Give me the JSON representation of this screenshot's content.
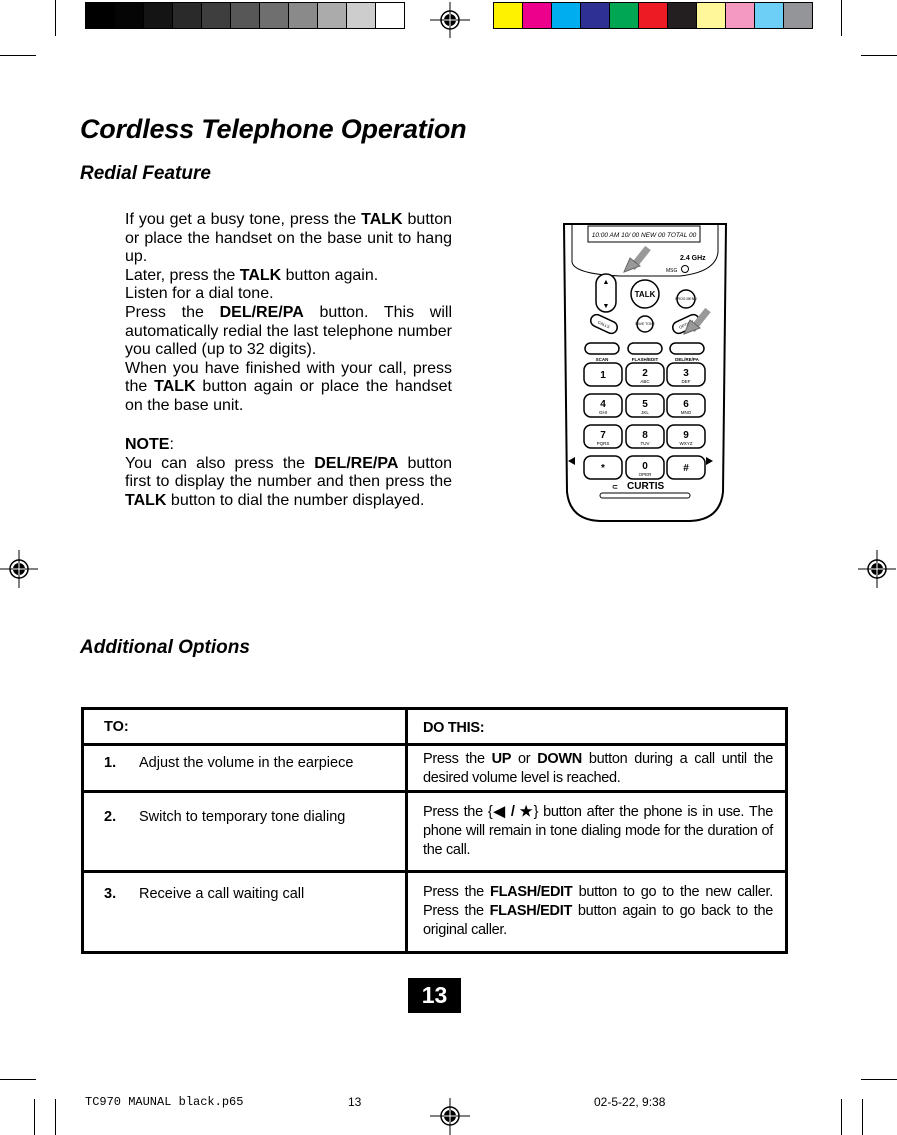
{
  "colors": {
    "grayscale": [
      "#000000",
      "#050505",
      "#141414",
      "#2a2a2a",
      "#3e3e3e",
      "#575757",
      "#6f6f6f",
      "#8a8a8a",
      "#ababab",
      "#cdcdcd",
      "#ffffff"
    ],
    "process": [
      "#fff200",
      "#ec008c",
      "#00aeef",
      "#2e3192",
      "#00a651",
      "#ed1c24",
      "#231f20",
      "#fff799",
      "#f49ac1",
      "#6dcff6",
      "#939598"
    ]
  },
  "title": "Cordless Telephone Operation",
  "redial": {
    "heading": "Redial Feature",
    "p1a": "If you get a busy tone, press the ",
    "talk": "TALK",
    "p1b": " button or place the handset on the base unit to hang up.",
    "p2a": "Later, press the ",
    "p2b": " button again.",
    "p3": "Listen for a dial tone.",
    "p4a": "Press the ",
    "del": "DEL/RE/PA",
    "p4b": " button. This will automatically redial the last telephone number you called (up to 32 digits).",
    "p5a": "When you have finished with your call, press the ",
    "p5b": " button again or place the handset on the base unit.",
    "note_label": "NOTE",
    "note_a": "You can also press the ",
    "note_b": " button first to display the number and then press the ",
    "note_c": " button to dial the number displayed."
  },
  "phone": {
    "display": "10:00 AM 10/ 00   NEW 00  TOTAL 00",
    "band": "2.4 GHz",
    "msg": "MSG",
    "talk": "TALK",
    "prog_menu": "PROG MENU",
    "calls": "CALLS",
    "save_tone": "SAVE TONE",
    "option": "OPTION",
    "soft_labels": [
      "SCAN",
      "FLASH/EDIT",
      "DEL/RE/PA"
    ],
    "keys": [
      [
        "1",
        ""
      ],
      [
        "2",
        "ABC"
      ],
      [
        "3",
        "DEF"
      ],
      [
        "4",
        "GHI"
      ],
      [
        "5",
        "JKL"
      ],
      [
        "6",
        "MNO"
      ],
      [
        "7",
        "PQRS"
      ],
      [
        "8",
        "TUV"
      ],
      [
        "9",
        "WXYZ"
      ],
      [
        "*",
        ""
      ],
      [
        "0",
        "OPER"
      ],
      [
        "#",
        ""
      ]
    ],
    "brand": "CURTIS"
  },
  "additional": {
    "heading": "Additional Options",
    "col_to": "TO:",
    "col_do": "DO THIS:",
    "rows": [
      {
        "num": "1.",
        "to": "Adjust the volume in the earpiece",
        "do_a": "Press the ",
        "k1": "UP",
        "mid": " or ",
        "k2": "DOWN",
        "do_b": " button during a call until the desired volume level is reached."
      },
      {
        "num": "2.",
        "to": "Switch to temporary tone dialing",
        "do_a": "Press the {",
        "k1": "◀ / ★",
        "do_b": "} button after the phone is in use. The phone will remain in tone dialing mode for the duration of the call."
      },
      {
        "num": "3.",
        "to": "Receive a call waiting call",
        "do_a": "Press the ",
        "k1": "FLASH/EDIT",
        "mid": " button to go to the new caller. Press the ",
        "k2": "FLASH/EDIT",
        "do_b": " button again to go back to the original caller."
      }
    ]
  },
  "page_number": "13",
  "footer": {
    "file": "TC970 MAUNAL black.p65",
    "page": "13",
    "date": "02-5-22, 9:38"
  }
}
